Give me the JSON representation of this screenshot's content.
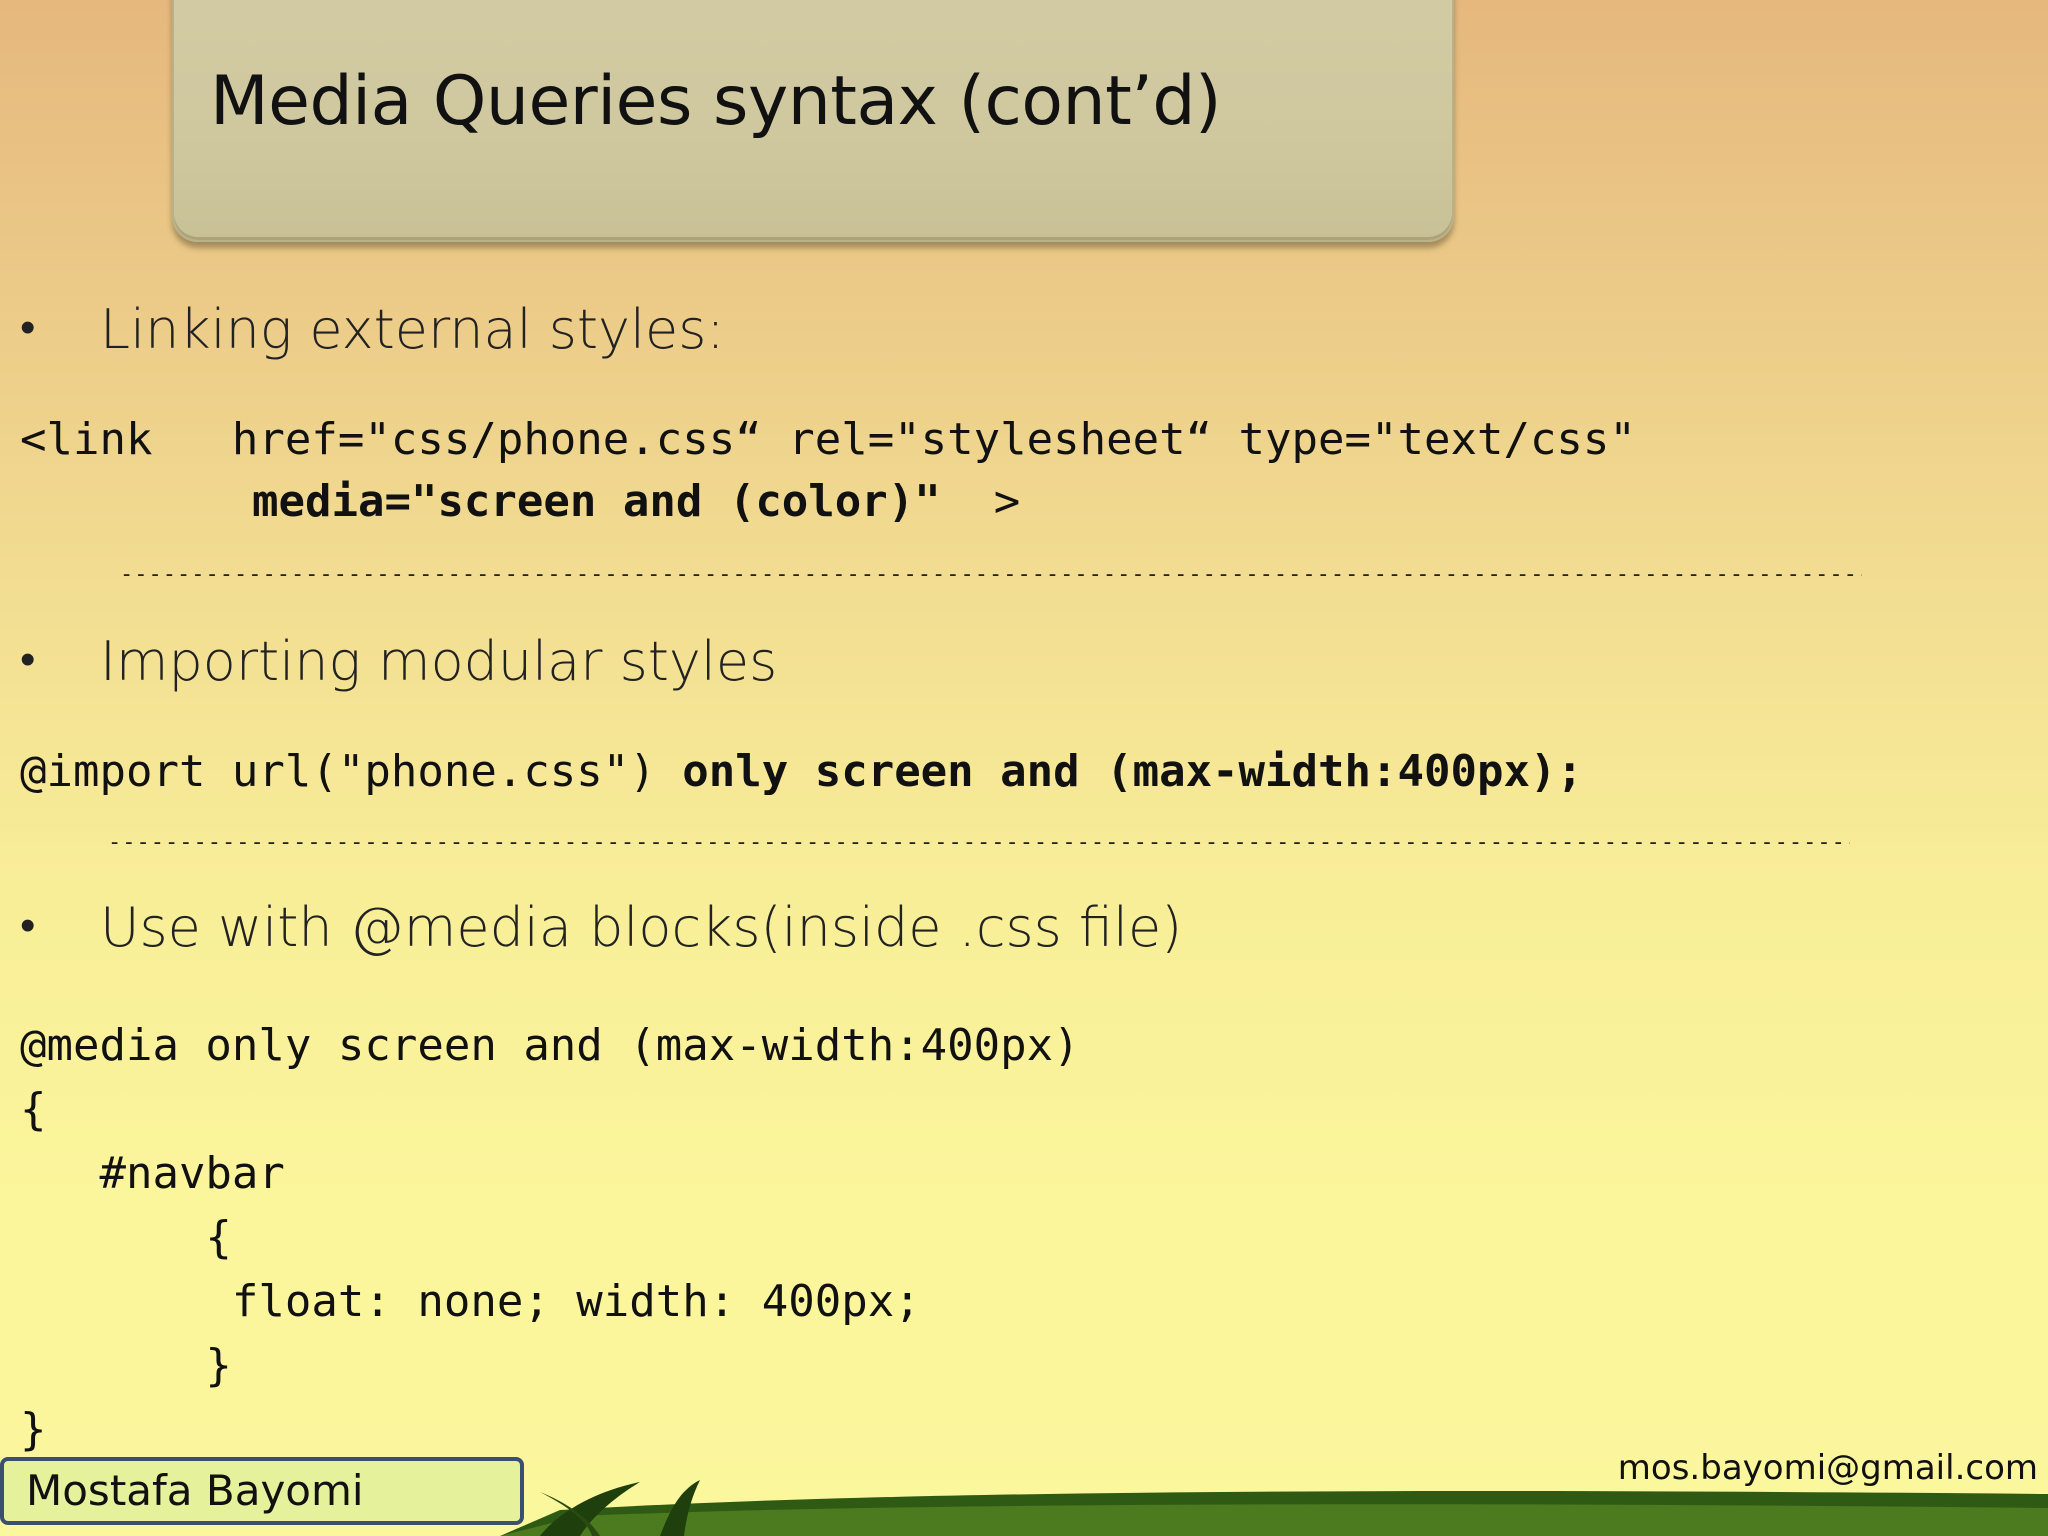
{
  "slide": {
    "title": "Media Queries syntax (cont’d)",
    "bullets": [
      "Linking external styles:",
      "Importing modular styles",
      "Use with @media blocks(inside .css file)"
    ],
    "bullet_symbol": "•",
    "code_link_line1": "<link   href=\"css/phone.css“ rel=\"stylesheet“ type=\"text/css\"",
    "code_link_line2": "media=\"screen and (color)\"",
    "code_link_line2_end": "  >",
    "code_import_normal": "@import url(\"phone.css\") ",
    "code_import_bold": "only screen and (max-width:400px);",
    "code_media_lines": [
      "@media only screen and (max-width:400px)",
      "{",
      "   #navbar",
      "       {",
      "        float: none; width: 400px;",
      "       }",
      "}"
    ],
    "separator": "---------------------------------------------------------------------------------------------------------------------------"
  },
  "footer": {
    "author": "Mostafa Bayomi",
    "email": "mos.bayomi@gmail.com"
  }
}
